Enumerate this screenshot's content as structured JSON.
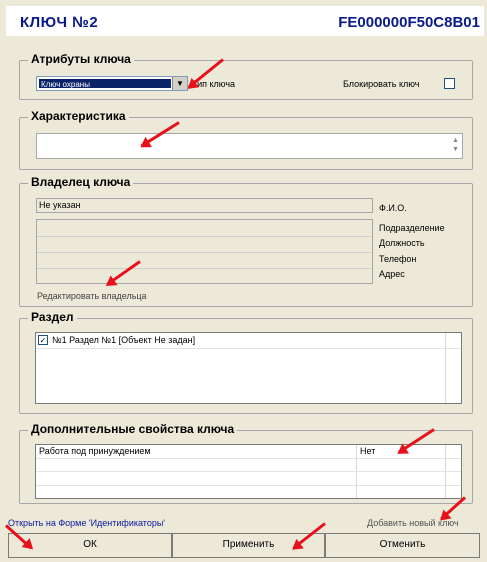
{
  "header": {
    "title": "КЛЮЧ №2",
    "code": "FE000000F50C8B01"
  },
  "attributes": {
    "legend": "Атрибуты ключа",
    "key_type_value": "Ключ охраны",
    "key_type_label": "Тип ключа",
    "block_label": "Блокировать ключ",
    "block_checked": false
  },
  "characteristic": {
    "legend": "Характеристика",
    "value": ""
  },
  "owner": {
    "legend": "Владелец ключа",
    "fio_value": "Не указан",
    "fio_label": "Ф.И.О.",
    "department_label": "Подразделение",
    "position_label": "Должность",
    "phone_label": "Телефон",
    "address_label": "Адрес",
    "edit_link": "Редактировать владельца"
  },
  "section": {
    "legend": "Раздел",
    "items": [
      {
        "label": "№1 Раздел №1  [Объект Не задан]",
        "checked": true
      }
    ]
  },
  "extra": {
    "legend": "Дополнительные свойства ключа",
    "rows": [
      {
        "name": "Работа под принуждением",
        "value": "Нет"
      }
    ]
  },
  "footer": {
    "open_link": "Открыть на Форме 'Идентификаторы'",
    "add_link": "Добавить новый ключ",
    "ok_label": "ОК",
    "apply_label": "Применить",
    "cancel_label": "Отменить"
  },
  "colors": {
    "title": "#0a1a8c",
    "link": "#0a1aa0",
    "annotation_arrow": "#e8101a"
  }
}
